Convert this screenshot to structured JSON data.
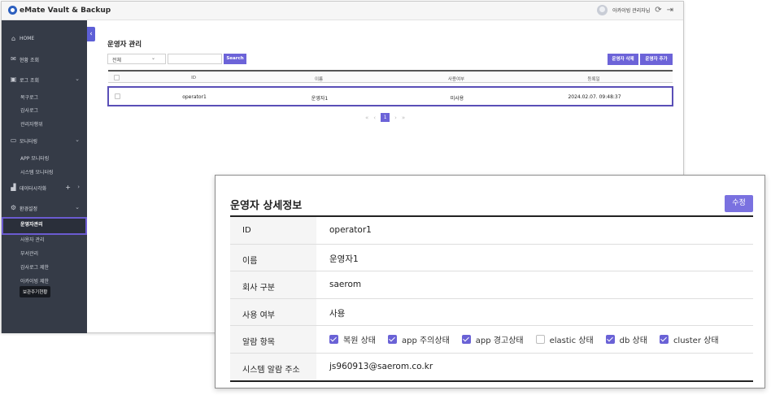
{
  "app": {
    "title": "eMate Vault & Backup",
    "user": "아카이빙 관리자님"
  },
  "sidebar": {
    "items": [
      {
        "label": "HOME",
        "icon": "home-icon"
      },
      {
        "label": "현황 조회",
        "icon": "mail-icon"
      },
      {
        "label": "로그 조회",
        "icon": "log-icon"
      },
      {
        "label": "복구로그"
      },
      {
        "label": "감사로그"
      },
      {
        "label": "관리자행위"
      },
      {
        "label": "모니터링",
        "icon": "monitor-icon"
      },
      {
        "label": "APP 모니터링"
      },
      {
        "label": "시스템 모니터링"
      },
      {
        "label": "데이터시각화",
        "icon": "chart-icon"
      },
      {
        "label": "환경설정",
        "icon": "gear-icon"
      },
      {
        "label": "운영자관리"
      },
      {
        "label": "사용자 관리"
      },
      {
        "label": "부서관리"
      },
      {
        "label": "감사로그 제한"
      },
      {
        "label": "아카이빙 제한"
      }
    ],
    "tooltip": "보관주기현황"
  },
  "main": {
    "title": "운영자 관리",
    "filter_value": "전체",
    "search_label": "Search",
    "delete_label": "운영자 삭제",
    "add_label": "운영자 추가",
    "columns": [
      "ID",
      "이름",
      "사용여부",
      "등록일"
    ],
    "rows": [
      {
        "id": "operator1",
        "name": "운영자1",
        "use": "미사용",
        "date": "2024.02.07. 09:48:37"
      }
    ],
    "page": "1"
  },
  "detail": {
    "title": "운영자 상세정보",
    "edit_label": "수정",
    "fields": [
      {
        "label": "ID",
        "value": "operator1"
      },
      {
        "label": "이름",
        "value": "운영자1"
      },
      {
        "label": "회사 구분",
        "value": "saerom"
      },
      {
        "label": "사용 여부",
        "value": "사용"
      },
      {
        "label": "알람 항목",
        "value": ""
      },
      {
        "label": "시스템 알람 주소",
        "value": "js960913@saerom.co.kr"
      }
    ],
    "alarms": [
      {
        "label": "복원 상태",
        "checked": true
      },
      {
        "label": "app 주의상태",
        "checked": true
      },
      {
        "label": "app 경고상태",
        "checked": true
      },
      {
        "label": "elastic 상태",
        "checked": false
      },
      {
        "label": "db 상태",
        "checked": true
      },
      {
        "label": "cluster 상태",
        "checked": true
      }
    ]
  },
  "colors": {
    "accent": "#6c63d8",
    "sidebar": "#353b47",
    "highlight": "#5a4fb7"
  }
}
